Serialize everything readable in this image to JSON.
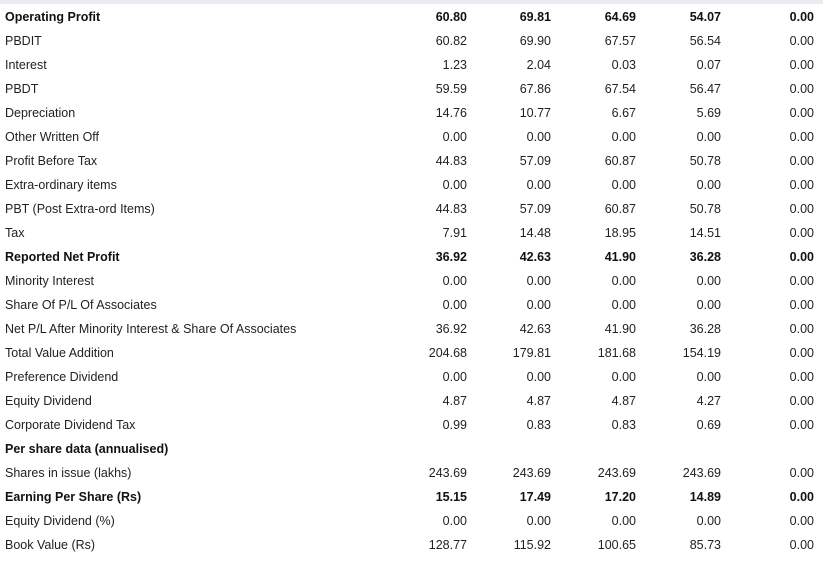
{
  "rows": [
    {
      "label": "Operating Profit",
      "bold": true,
      "values": [
        "60.80",
        "69.81",
        "64.69",
        "54.07",
        "0.00"
      ]
    },
    {
      "label": "PBDIT",
      "values": [
        "60.82",
        "69.90",
        "67.57",
        "56.54",
        "0.00"
      ]
    },
    {
      "label": "Interest",
      "values": [
        "1.23",
        "2.04",
        "0.03",
        "0.07",
        "0.00"
      ]
    },
    {
      "label": "PBDT",
      "values": [
        "59.59",
        "67.86",
        "67.54",
        "56.47",
        "0.00"
      ]
    },
    {
      "label": "Depreciation",
      "values": [
        "14.76",
        "10.77",
        "6.67",
        "5.69",
        "0.00"
      ]
    },
    {
      "label": "Other Written Off",
      "values": [
        "0.00",
        "0.00",
        "0.00",
        "0.00",
        "0.00"
      ]
    },
    {
      "label": "Profit Before Tax",
      "values": [
        "44.83",
        "57.09",
        "60.87",
        "50.78",
        "0.00"
      ]
    },
    {
      "label": "Extra-ordinary items",
      "values": [
        "0.00",
        "0.00",
        "0.00",
        "0.00",
        "0.00"
      ]
    },
    {
      "label": "PBT (Post Extra-ord Items)",
      "values": [
        "44.83",
        "57.09",
        "60.87",
        "50.78",
        "0.00"
      ]
    },
    {
      "label": "Tax",
      "values": [
        "7.91",
        "14.48",
        "18.95",
        "14.51",
        "0.00"
      ]
    },
    {
      "label": "Reported Net Profit",
      "bold": true,
      "values": [
        "36.92",
        "42.63",
        "41.90",
        "36.28",
        "0.00"
      ]
    },
    {
      "label": "Minority Interest",
      "values": [
        "0.00",
        "0.00",
        "0.00",
        "0.00",
        "0.00"
      ]
    },
    {
      "label": "Share Of P/L Of Associates",
      "values": [
        "0.00",
        "0.00",
        "0.00",
        "0.00",
        "0.00"
      ]
    },
    {
      "label": "Net P/L After Minority Interest & Share Of Associates",
      "values": [
        "36.92",
        "42.63",
        "41.90",
        "36.28",
        "0.00"
      ]
    },
    {
      "label": "Total Value Addition",
      "values": [
        "204.68",
        "179.81",
        "181.68",
        "154.19",
        "0.00"
      ]
    },
    {
      "label": "Preference Dividend",
      "values": [
        "0.00",
        "0.00",
        "0.00",
        "0.00",
        "0.00"
      ]
    },
    {
      "label": "Equity Dividend",
      "values": [
        "4.87",
        "4.87",
        "4.87",
        "4.27",
        "0.00"
      ]
    },
    {
      "label": "Corporate Dividend Tax",
      "values": [
        "0.99",
        "0.83",
        "0.83",
        "0.69",
        "0.00"
      ]
    },
    {
      "label": "Per share data (annualised)",
      "bold": true,
      "values": [
        "",
        "",
        "",
        "",
        ""
      ]
    },
    {
      "label": "Shares in issue (lakhs)",
      "values": [
        "243.69",
        "243.69",
        "243.69",
        "243.69",
        "0.00"
      ]
    },
    {
      "label": "Earning Per Share (Rs)",
      "bold": true,
      "values": [
        "15.15",
        "17.49",
        "17.20",
        "14.89",
        "0.00"
      ]
    },
    {
      "label": "Equity Dividend (%)",
      "values": [
        "0.00",
        "0.00",
        "0.00",
        "0.00",
        "0.00"
      ]
    },
    {
      "label": "Book Value (Rs)",
      "values": [
        "128.77",
        "115.92",
        "100.65",
        "85.73",
        "0.00"
      ]
    }
  ]
}
